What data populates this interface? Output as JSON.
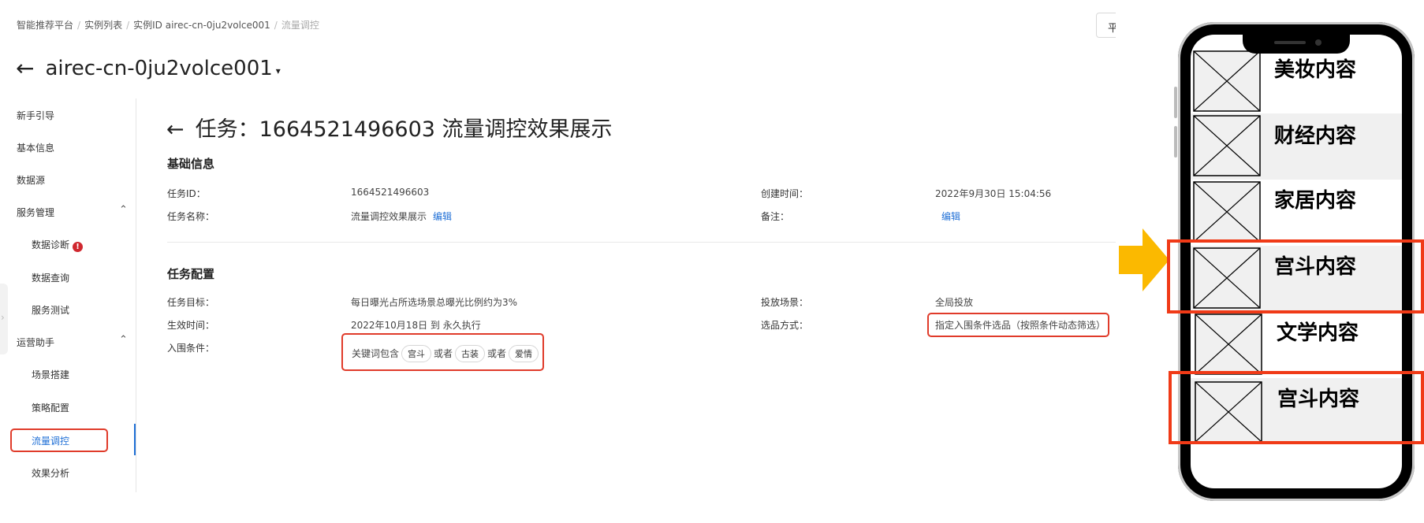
{
  "breadcrumb": [
    "智能推荐平台",
    "实例列表",
    "实例ID airec-cn-0ju2volce001",
    "流量调控"
  ],
  "top_button": "平",
  "instance_title": "airec-cn-0ju2volce001",
  "icons": {
    "back": "←",
    "caret": "▾",
    "chevron_up": "⌃",
    "alert": "!",
    "handle": "›"
  },
  "sidebar": {
    "guide": "新手引导",
    "basic_info": "基本信息",
    "datasource": "数据源",
    "service_mgmt": "服务管理",
    "data_diagnosis": "数据诊断",
    "data_query": "数据查询",
    "service_test": "服务测试",
    "ops_assistant": "运营助手",
    "scene_build": "场景搭建",
    "strategy_config": "策略配置",
    "traffic_control": "流量调控",
    "effect_analysis": "效果分析"
  },
  "task": {
    "title": "任务：1664521496603 流量调控效果展示",
    "basic_section": "基础信息",
    "task_id_label": "任务ID：",
    "task_id": "1664521496603",
    "created_label": "创建时间：",
    "created": "2022年9月30日 15:04:56",
    "name_label": "任务名称：",
    "name": "流量调控效果展示",
    "edit": "编辑",
    "note_label": "备注：",
    "config_section": "任务配置",
    "goal_label": "任务目标：",
    "goal": "每日曝光占所选场景总曝光比例约为3%",
    "scene_label": "投放场景：",
    "scene": "全局投放",
    "effective_label": "生效时间：",
    "effective": "2022年10月18日 到 永久执行",
    "selection_label": "选品方式：",
    "selection": "指定入围条件选品（按照条件动态筛选）",
    "condition_label": "入围条件：",
    "condition_prefix": "关键词包含",
    "or": "或者",
    "keywords": [
      "宫斗",
      "古装",
      "爱情"
    ]
  },
  "phone_feed": [
    "美妆内容",
    "财经内容",
    "家居内容",
    "宫斗内容",
    "文学内容",
    "宫斗内容"
  ],
  "colors": {
    "accent": "#1f6fd6",
    "highlight_box": "#e03b2a",
    "arrow": "#fbb900",
    "alert": "#d0282f"
  }
}
